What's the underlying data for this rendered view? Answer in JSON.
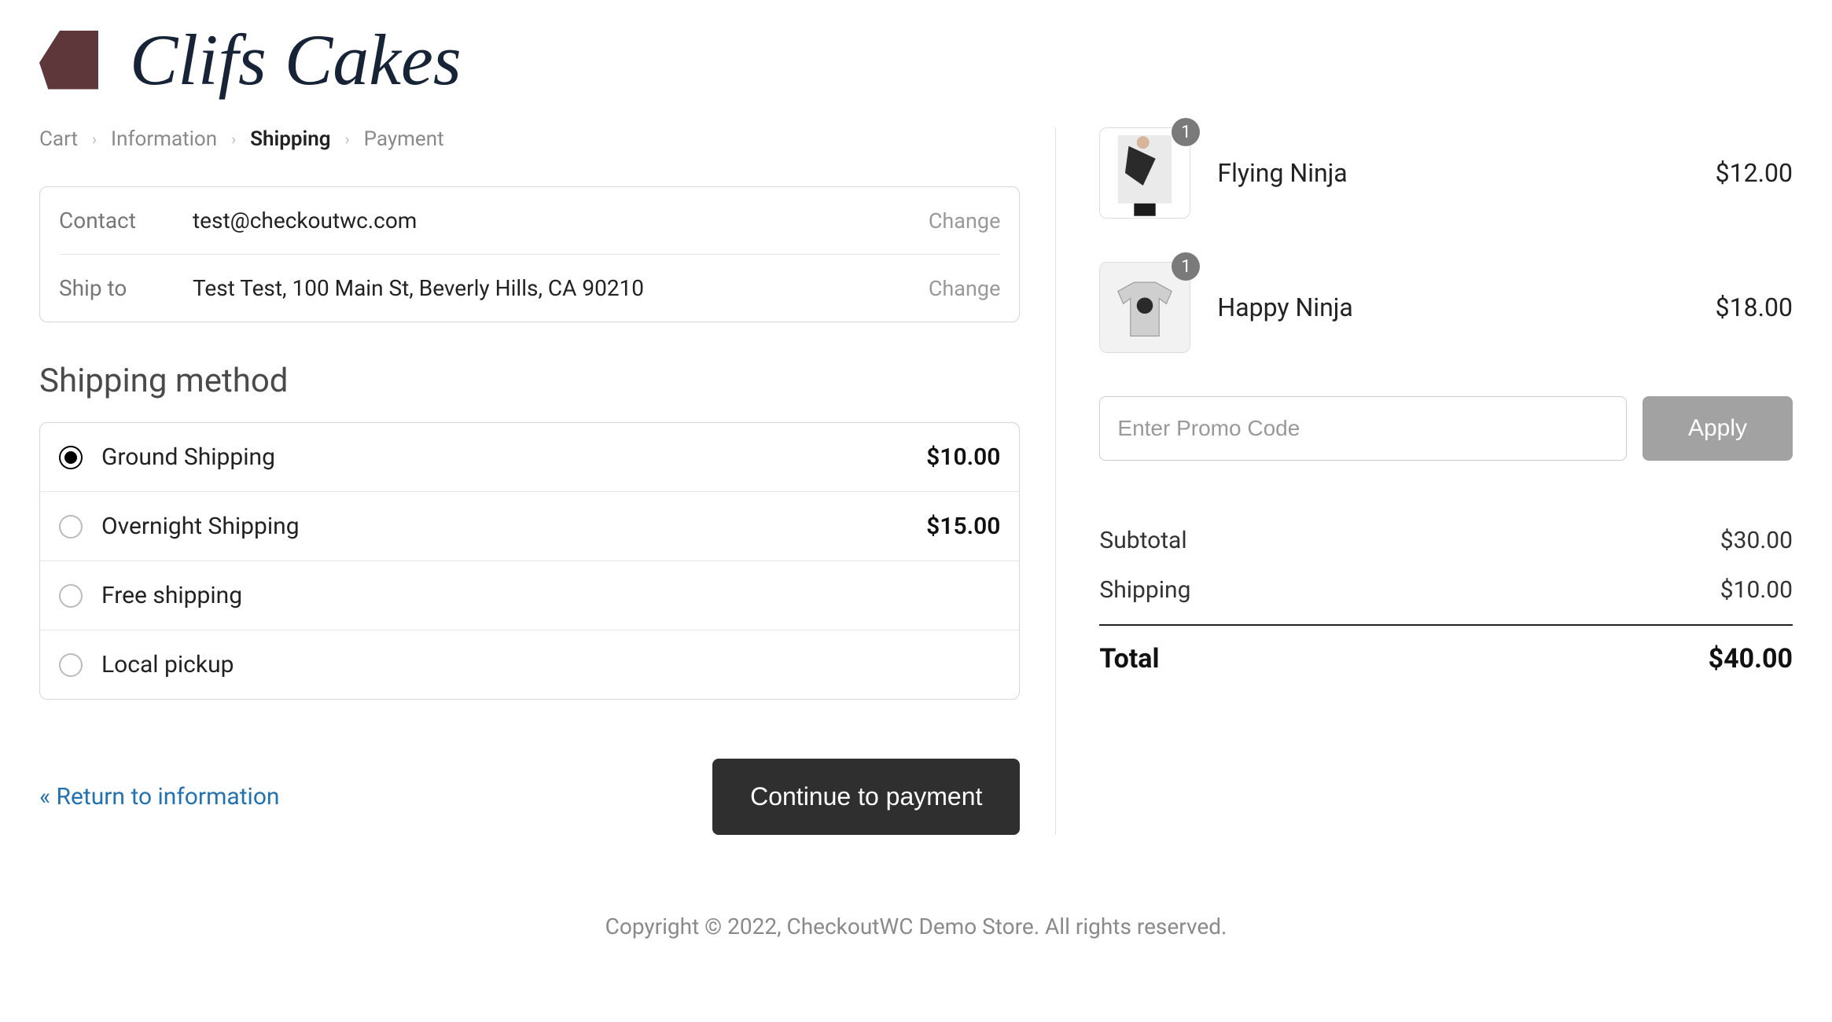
{
  "brand": {
    "name": "Clifs Cakes"
  },
  "breadcrumbs": {
    "cart": "Cart",
    "information": "Information",
    "shipping": "Shipping",
    "payment": "Payment",
    "active": "shipping"
  },
  "summary": {
    "contact_label": "Contact",
    "contact_value": "test@checkoutwc.com",
    "shipto_label": "Ship to",
    "shipto_value": "Test Test, 100 Main St, Beverly Hills, CA 90210",
    "change_label": "Change"
  },
  "shipping_section": {
    "title": "Shipping method",
    "methods": [
      {
        "name": "Ground Shipping",
        "price": "$10.00",
        "selected": true
      },
      {
        "name": "Overnight Shipping",
        "price": "$15.00",
        "selected": false
      },
      {
        "name": "Free shipping",
        "price": "",
        "selected": false
      },
      {
        "name": "Local pickup",
        "price": "",
        "selected": false
      }
    ]
  },
  "actions": {
    "return_label": "« Return to information",
    "continue_label": "Continue to payment"
  },
  "cart": {
    "items": [
      {
        "name": "Flying Ninja",
        "price": "$12.00",
        "qty": "1"
      },
      {
        "name": "Happy Ninja",
        "price": "$18.00",
        "qty": "1"
      }
    ],
    "promo_placeholder": "Enter Promo Code",
    "apply_label": "Apply",
    "subtotal_label": "Subtotal",
    "subtotal_value": "$30.00",
    "shipping_label": "Shipping",
    "shipping_value": "$10.00",
    "total_label": "Total",
    "total_value": "$40.00"
  },
  "footer": {
    "text": "Copyright © 2022, CheckoutWC Demo Store. All rights reserved."
  }
}
